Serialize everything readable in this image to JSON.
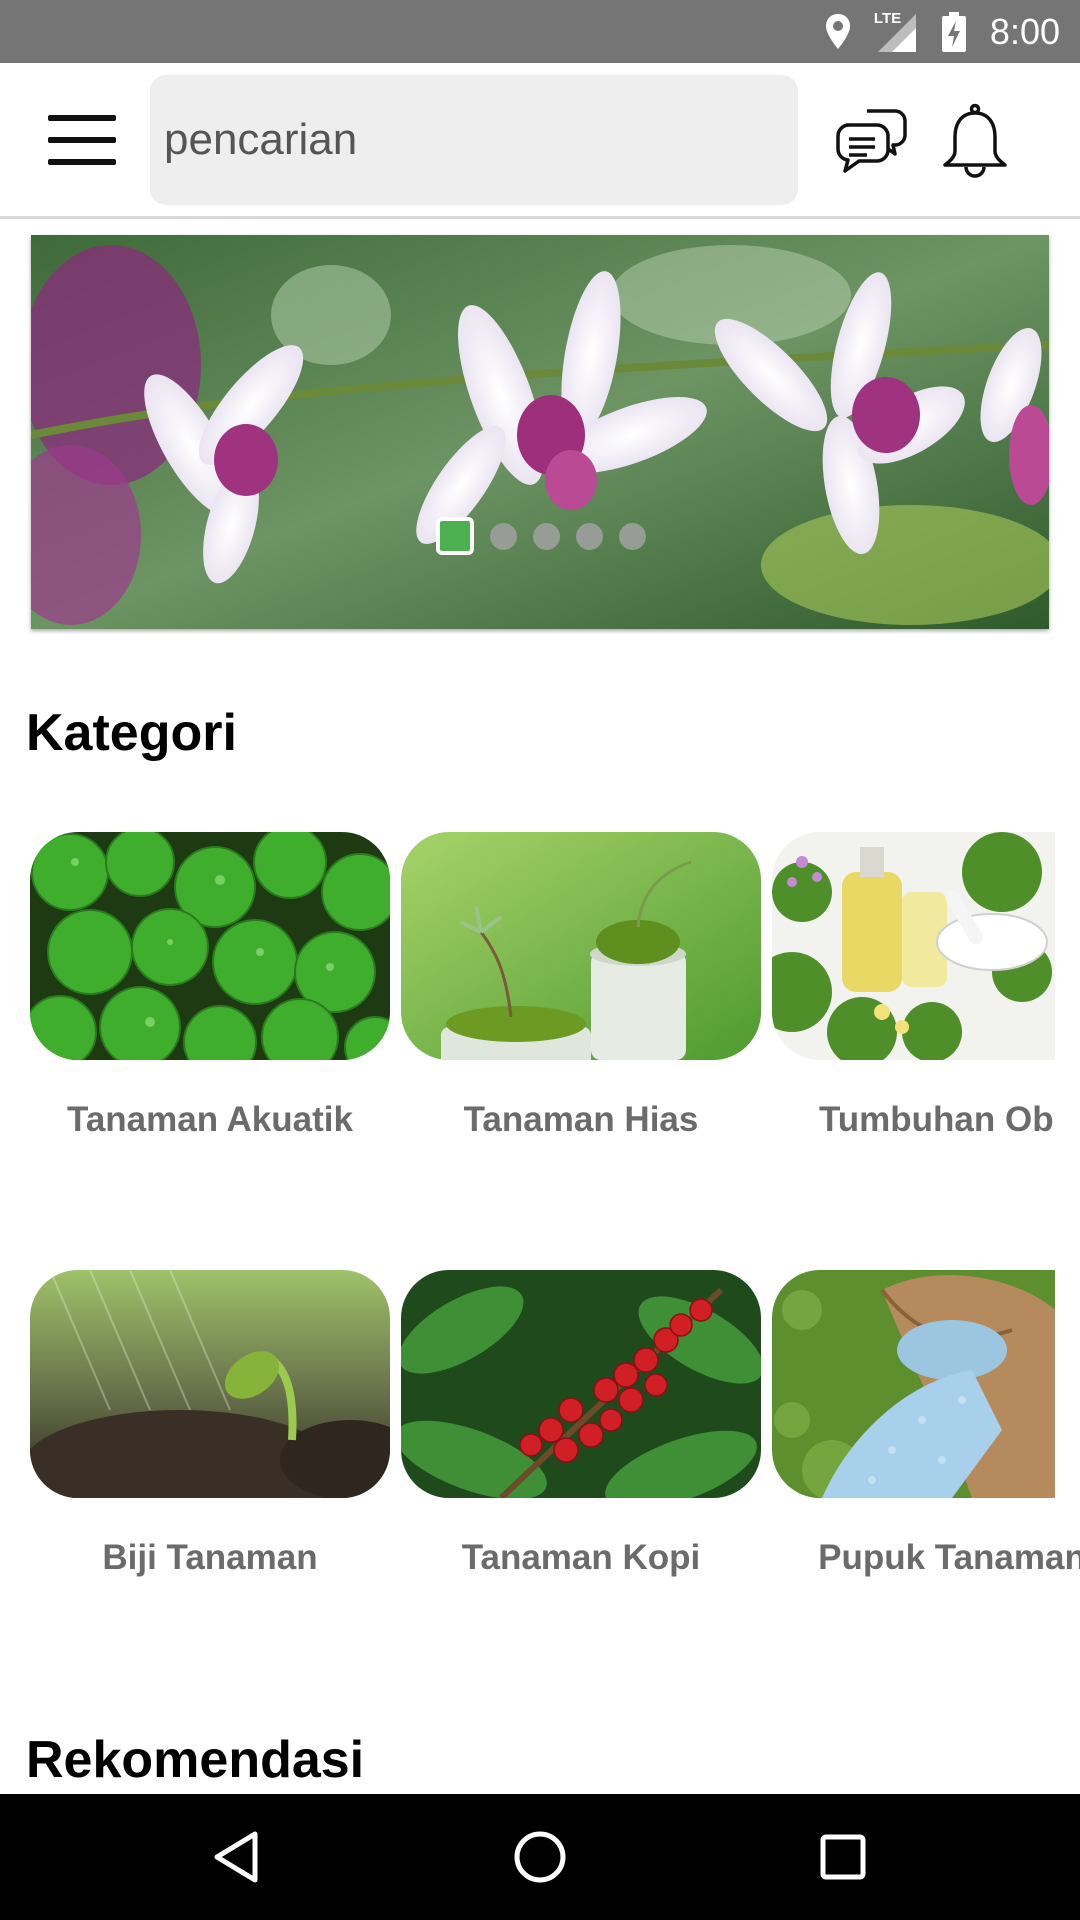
{
  "status_bar": {
    "time": "8:00",
    "network_label": "LTE",
    "icons": [
      "location-icon",
      "signal-icon",
      "battery-charging-icon"
    ]
  },
  "app_bar": {
    "menu_icon": "hamburger-menu-icon",
    "search": {
      "placeholder": "pencarian",
      "value": ""
    },
    "chat_icon": "chat-bubbles-icon",
    "notification_icon": "bell-icon"
  },
  "banner": {
    "image": "orchid-flowers-photo",
    "slide_count": 5,
    "active_slide": 1
  },
  "categories": {
    "title": "Kategori",
    "items": [
      {
        "label": "Tanaman Akuatik",
        "image": "aquatic-plant-photo"
      },
      {
        "label": "Tanaman Hias",
        "image": "ornamental-plant-photo"
      },
      {
        "label": "Tumbuhan Ob",
        "image": "medicinal-herbs-photo"
      },
      {
        "label": "Biji Tanaman",
        "image": "sprouting-seed-photo"
      },
      {
        "label": "Tanaman Kopi",
        "image": "coffee-cherries-photo"
      },
      {
        "label": "Pupuk Tanaman",
        "image": "fertilizer-sack-photo"
      }
    ]
  },
  "recommendations": {
    "title": "Rekomendasi"
  },
  "nav_bar": {
    "icons": [
      "back-icon",
      "home-icon",
      "recents-icon"
    ]
  },
  "colors": {
    "status_bar": "#757575",
    "accent_green": "#4caf50",
    "search_bg": "#eeeeee",
    "label_gray": "#6b6b6b",
    "nav_bar": "#000000"
  }
}
